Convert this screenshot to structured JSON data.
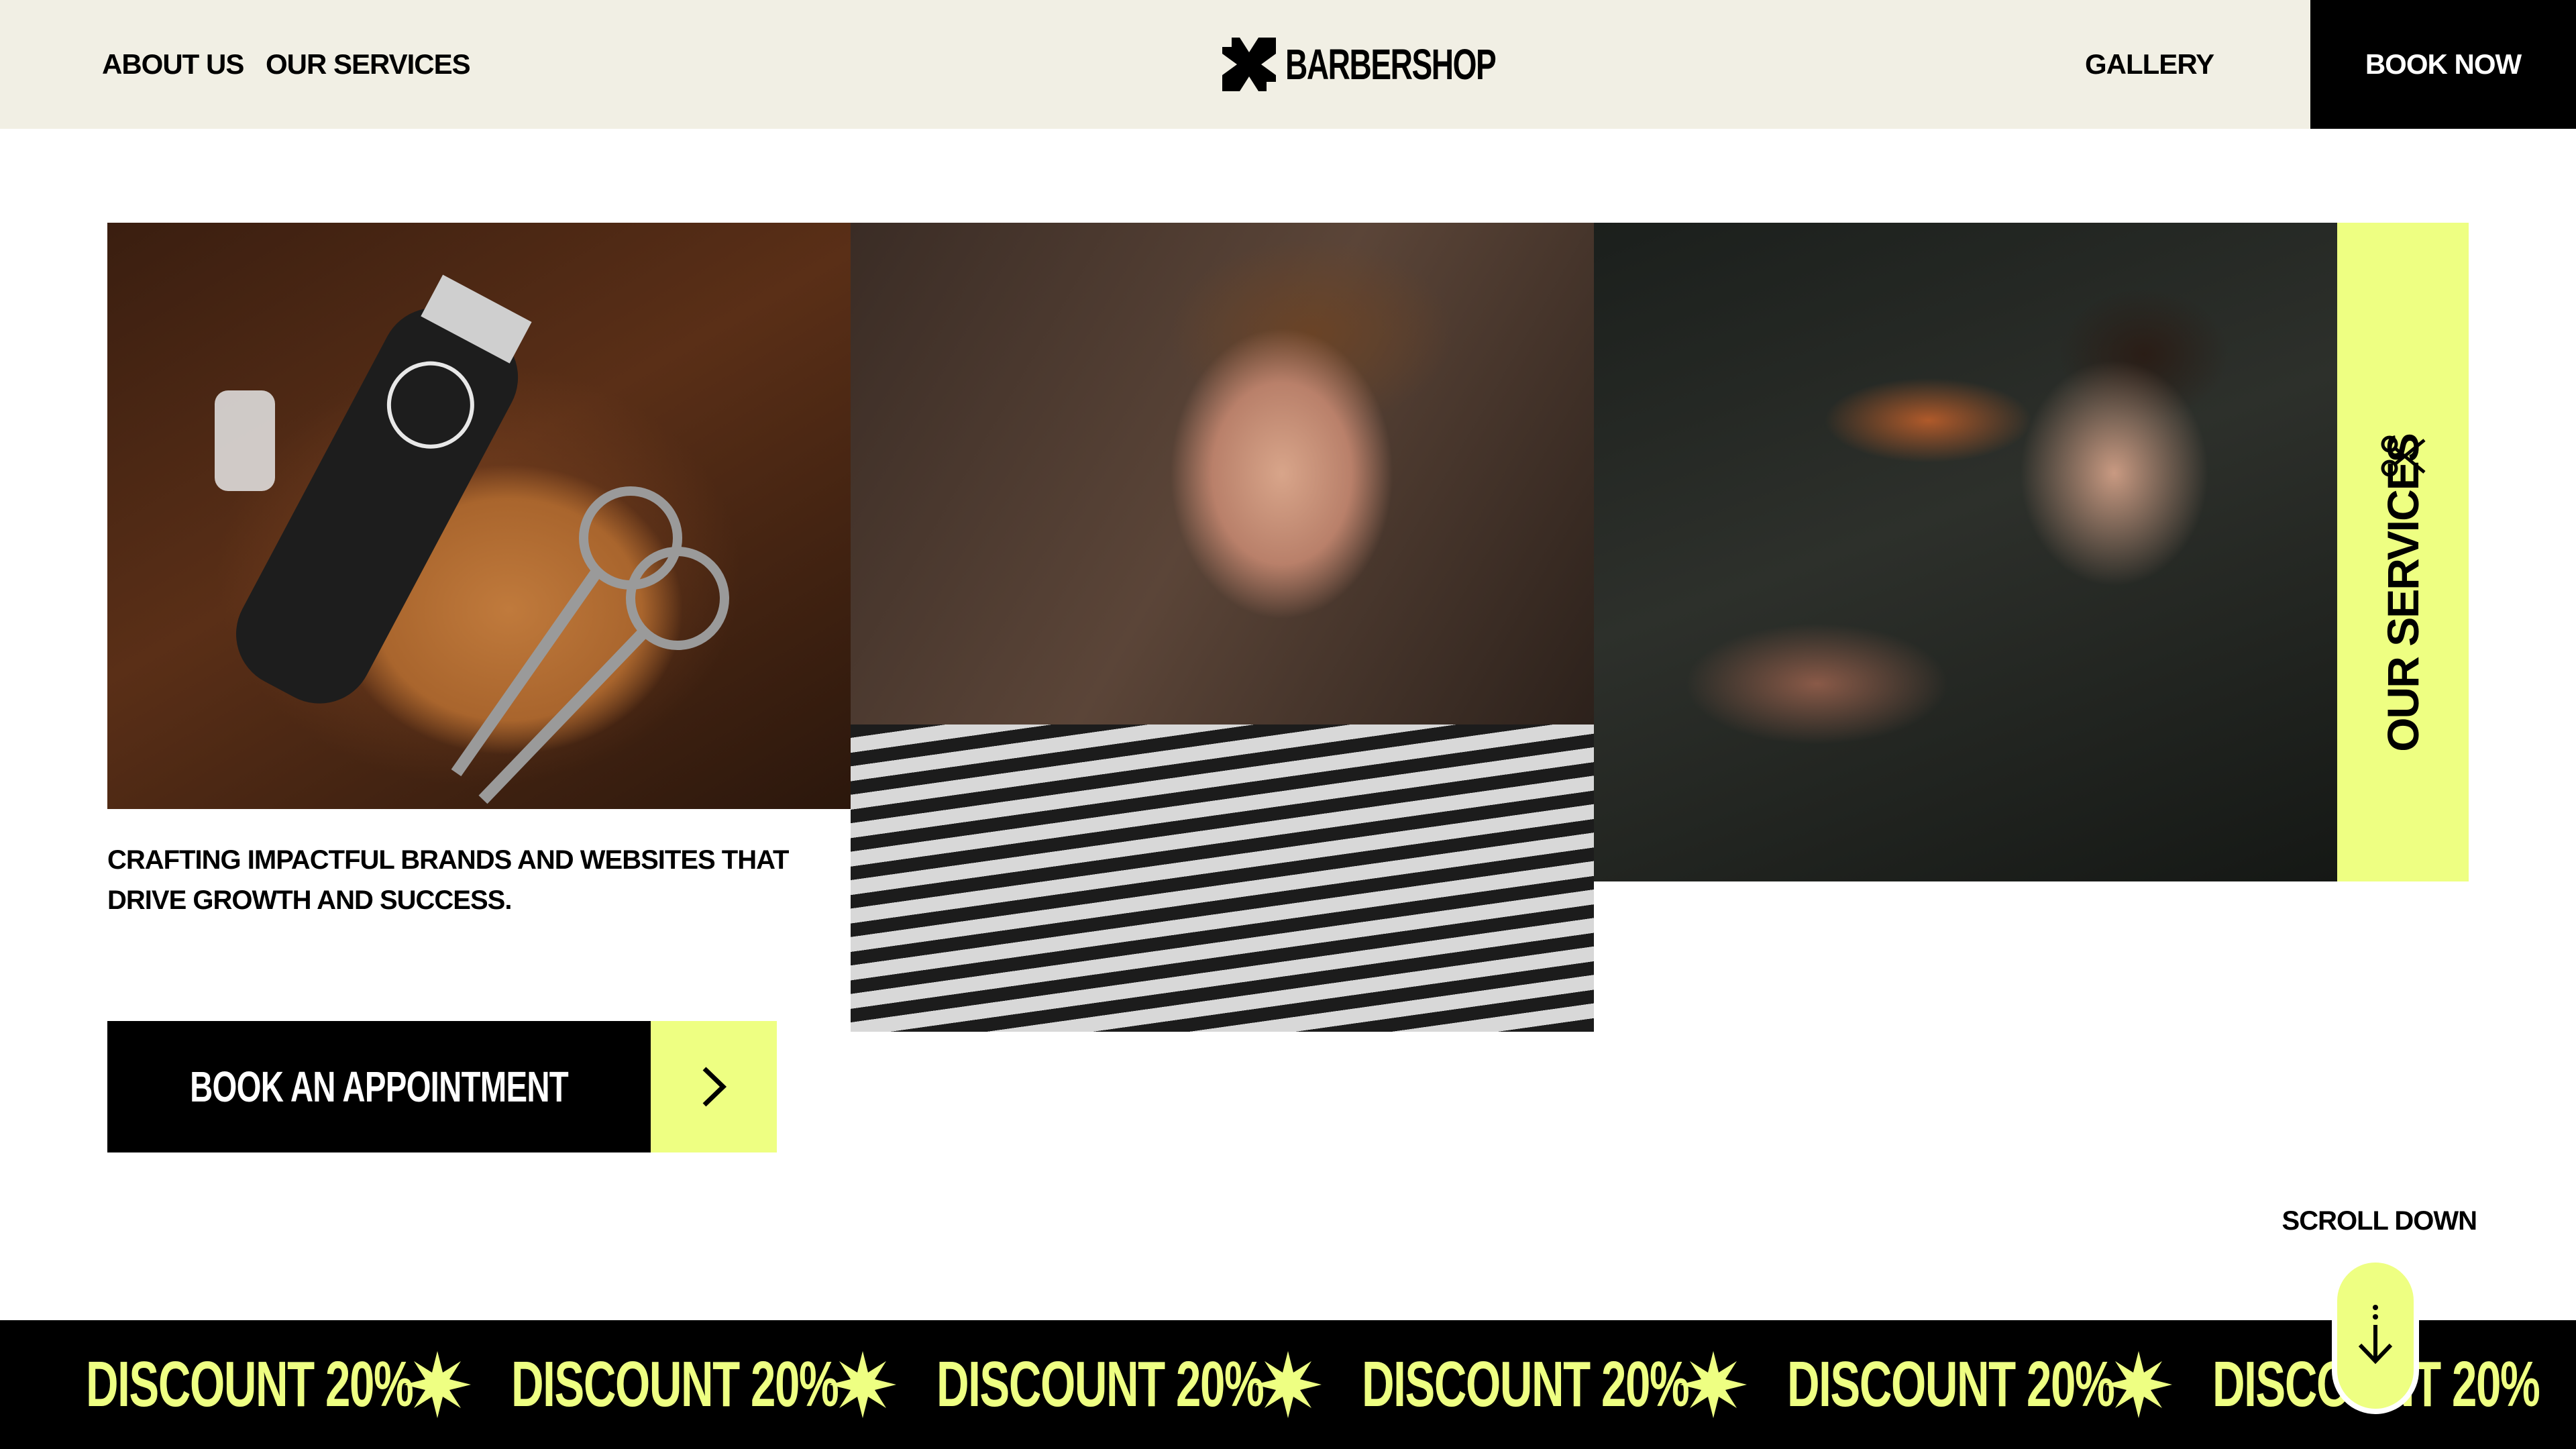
{
  "header": {
    "nav_left": [
      "ABOUT US",
      "OUR SERVICES"
    ],
    "brand": "BARBERSHOP",
    "nav_right": "GALLERY",
    "cta": "BOOK NOW"
  },
  "hero": {
    "tagline": "CRAFTING IMPACTFUL BRANDS AND WEBSITES THAT DRIVE GROWTH AND SUCCESS.",
    "book_button": "BOOK AN APPOINTMENT",
    "services_tab": "OUR SERVICES",
    "scroll_label": "SCROLL DOWN"
  },
  "marquee": {
    "items": [
      "DISCOUNT 20%",
      "DISCOUNT 20%",
      "DISCOUNT 20%",
      "DISCOUNT 20%",
      "DISCOUNT 20%",
      "DISCOUNT 20%"
    ]
  },
  "colors": {
    "accent": "#eeff82",
    "header_bg": "#f1efe4",
    "dark": "#000000"
  },
  "icons": {
    "logo": "barbershop-logo-icon",
    "cta_arrow": "chevron-right-icon",
    "tab": "scissors-icon",
    "marquee": "star-burst-icon",
    "scroll": "arrow-down-icon"
  }
}
